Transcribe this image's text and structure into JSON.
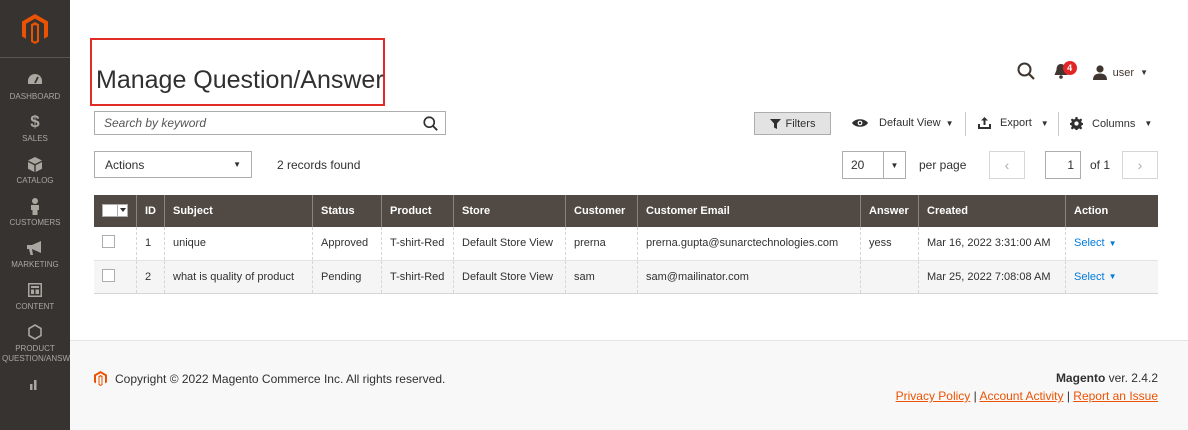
{
  "brand": {
    "accent": "#eb5202",
    "sidebar_bg": "#373330",
    "header_bg": "#514943",
    "link": "#007bdb"
  },
  "sidebar": {
    "items": [
      {
        "label": "DASHBOARD",
        "icon": "dashboard-icon"
      },
      {
        "label": "SALES",
        "icon": "dollar-icon"
      },
      {
        "label": "CATALOG",
        "icon": "box-icon"
      },
      {
        "label": "CUSTOMERS",
        "icon": "person-icon"
      },
      {
        "label": "MARKETING",
        "icon": "megaphone-icon"
      },
      {
        "label": "CONTENT",
        "icon": "layout-icon"
      },
      {
        "label": "PRODUCT QUESTION/ANSWER",
        "icon": "hexagon-icon"
      }
    ]
  },
  "header": {
    "title": "Manage Question/Answer",
    "notifications_count": "4",
    "user_label": "user"
  },
  "search": {
    "placeholder": "Search by keyword"
  },
  "toolbar": {
    "filters_label": "Filters",
    "view_label": "Default View",
    "export_label": "Export",
    "columns_label": "Columns"
  },
  "mass_actions": {
    "label": "Actions",
    "records_text": "2 records found"
  },
  "pagination": {
    "per_page": "20",
    "per_page_label": "per page",
    "current_page": "1",
    "of_text": "of 1"
  },
  "grid": {
    "columns": [
      "ID",
      "Subject",
      "Status",
      "Product",
      "Store",
      "Customer",
      "Customer Email",
      "Answer",
      "Created",
      "Action"
    ],
    "rows": [
      {
        "id": "1",
        "subject": "unique",
        "status": "Approved",
        "product": "T-shirt-Red",
        "store": "Default Store View",
        "customer": "prerna",
        "email": "prerna.gupta@sunarctechnologies.com",
        "answer": "yess",
        "created": "Mar 16, 2022 3:31:00 AM",
        "action": "Select"
      },
      {
        "id": "2",
        "subject": "what is quality of product",
        "status": "Pending",
        "product": "T-shirt-Red",
        "store": "Default Store View",
        "customer": "sam",
        "email": "sam@mailinator.com",
        "answer": "",
        "created": "Mar 25, 2022 7:08:08 AM",
        "action": "Select"
      }
    ]
  },
  "footer": {
    "copyright": "Copyright © 2022 Magento Commerce Inc. All rights reserved.",
    "version_brand": "Magento",
    "version_text": "ver. 2.4.2",
    "links": [
      "Privacy Policy",
      "Account Activity",
      "Report an Issue"
    ]
  }
}
